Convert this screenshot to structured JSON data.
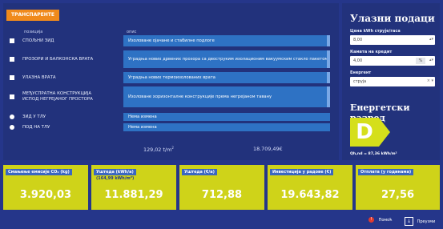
{
  "left": {
    "tab_label": "ТРАНСПАРЕНТЕ",
    "col_headers": [
      "позиција",
      "опис"
    ],
    "rows": [
      {
        "name": "СПОЉНИ ЗИД",
        "desc": "Изоловане ојачане и стабилне подлоге",
        "type": "square"
      },
      {
        "name": "ПРОЗОРИ И БАЛКОНСКА ВРАТА",
        "desc": "Уградња нових дрвених прозора са двоструким изолационим вакуумским стакло пакетом",
        "type": "square"
      },
      {
        "name": "УЛАЗНА ВРАТА",
        "desc": "Уградња нових термоизолованих врата",
        "type": "square"
      },
      {
        "name": "МЕЂУСПРАТНА КОНСТРУКЦИЈА ИСПОД НЕГРЕЈАНОГ ПРОСТОРА",
        "desc": "Изоловане хоризонталне конструкције према негрејаном тавану",
        "type": "square"
      },
      {
        "name": "ЗИД У ТЛУ",
        "desc": "Нема измена",
        "type": "round"
      },
      {
        "name": "ПОД НА ТЛУ",
        "desc": "Нема измена",
        "type": "round"
      }
    ],
    "area_total": "129,02 ",
    "area_unit": "m",
    "area_sup": "2",
    "area_suffix": "t/",
    "cost_total": "18.709,49€"
  },
  "right": {
    "title": "Улазни подаци",
    "fields": [
      {
        "label": "Цена kWh струје/гаса",
        "value": "8,00",
        "unit": ""
      },
      {
        "label": "Камата на кредит",
        "value": "4,00",
        "unit": "%"
      },
      {
        "label": "Енергент",
        "value": "струја",
        "unit": ""
      }
    ],
    "energy_title": "Енергетски разред",
    "energy_class": "D",
    "qh": "Qh,nd = 87,36 kWh/m²"
  },
  "cards": [
    {
      "label": "Смањење емисије CO₂ (kg)",
      "sub": "",
      "value": "3.920,03"
    },
    {
      "label": "Уштеда (kWh/a)",
      "sub": "(164,99 kWh/m²)",
      "value": "11.881,29"
    },
    {
      "label": "Уштеда (€/a)",
      "sub": "",
      "value": "712,88"
    },
    {
      "label": "Инвестиција у радове (€)",
      "sub": "",
      "value": "19.643,82"
    },
    {
      "label": "Отплата (у годинама)",
      "sub": "",
      "value": "27,56"
    }
  ],
  "footer": {
    "help": "Помоћ",
    "download": "Преузми"
  },
  "colors": {
    "accent": "#f08a1c",
    "badge": "#d5df1b",
    "card": "#cfd319",
    "desc": "#2e72c4",
    "bg": "#25368a"
  }
}
